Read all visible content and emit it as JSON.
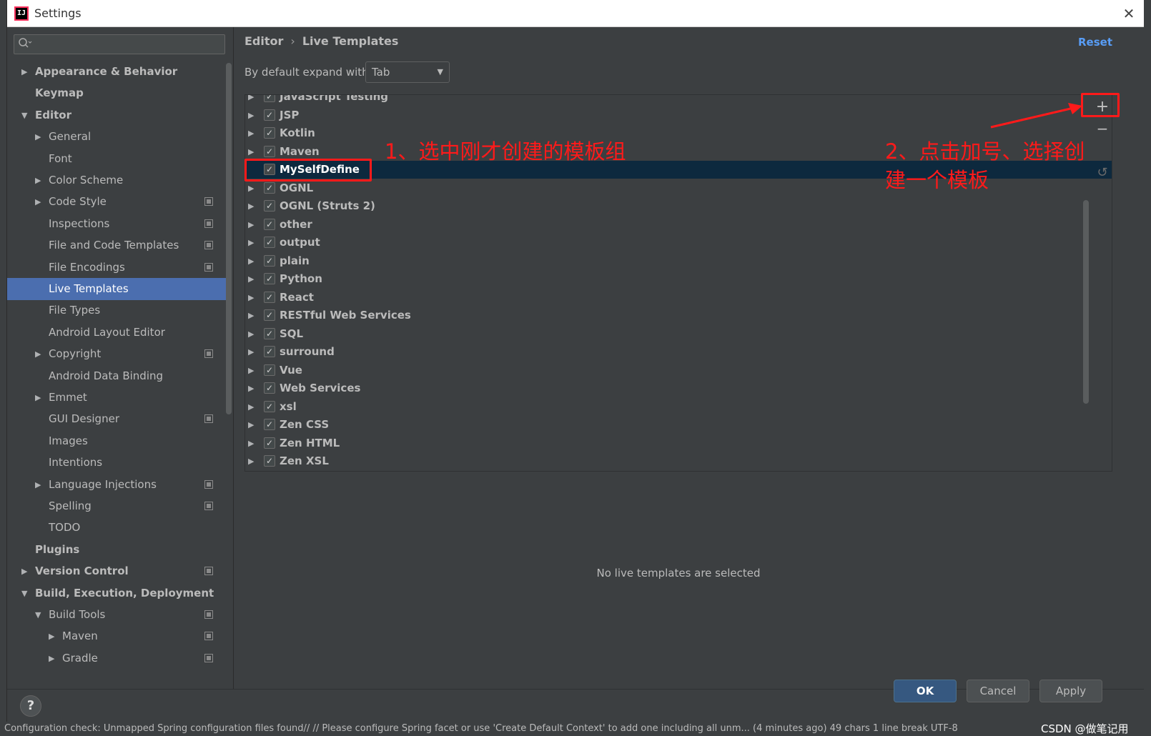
{
  "window": {
    "title": "Settings"
  },
  "search": {
    "placeholder": ""
  },
  "tree": [
    {
      "label": "Appearance & Behavior",
      "level": 0,
      "arrow": "right",
      "bold": true,
      "copy": false,
      "selected": false
    },
    {
      "label": "Keymap",
      "level": 0,
      "arrow": "none",
      "bold": true,
      "copy": false,
      "selected": false
    },
    {
      "label": "Editor",
      "level": 0,
      "arrow": "down",
      "bold": true,
      "copy": false,
      "selected": false
    },
    {
      "label": "General",
      "level": 1,
      "arrow": "right",
      "bold": false,
      "copy": false,
      "selected": false
    },
    {
      "label": "Font",
      "level": 1,
      "arrow": "none",
      "bold": false,
      "copy": false,
      "selected": false
    },
    {
      "label": "Color Scheme",
      "level": 1,
      "arrow": "right",
      "bold": false,
      "copy": false,
      "selected": false
    },
    {
      "label": "Code Style",
      "level": 1,
      "arrow": "right",
      "bold": false,
      "copy": true,
      "selected": false
    },
    {
      "label": "Inspections",
      "level": 1,
      "arrow": "none",
      "bold": false,
      "copy": true,
      "selected": false
    },
    {
      "label": "File and Code Templates",
      "level": 1,
      "arrow": "none",
      "bold": false,
      "copy": true,
      "selected": false
    },
    {
      "label": "File Encodings",
      "level": 1,
      "arrow": "none",
      "bold": false,
      "copy": true,
      "selected": false
    },
    {
      "label": "Live Templates",
      "level": 1,
      "arrow": "none",
      "bold": false,
      "copy": false,
      "selected": true
    },
    {
      "label": "File Types",
      "level": 1,
      "arrow": "none",
      "bold": false,
      "copy": false,
      "selected": false
    },
    {
      "label": "Android Layout Editor",
      "level": 1,
      "arrow": "none",
      "bold": false,
      "copy": false,
      "selected": false
    },
    {
      "label": "Copyright",
      "level": 1,
      "arrow": "right",
      "bold": false,
      "copy": true,
      "selected": false
    },
    {
      "label": "Android Data Binding",
      "level": 1,
      "arrow": "none",
      "bold": false,
      "copy": false,
      "selected": false
    },
    {
      "label": "Emmet",
      "level": 1,
      "arrow": "right",
      "bold": false,
      "copy": false,
      "selected": false
    },
    {
      "label": "GUI Designer",
      "level": 1,
      "arrow": "none",
      "bold": false,
      "copy": true,
      "selected": false
    },
    {
      "label": "Images",
      "level": 1,
      "arrow": "none",
      "bold": false,
      "copy": false,
      "selected": false
    },
    {
      "label": "Intentions",
      "level": 1,
      "arrow": "none",
      "bold": false,
      "copy": false,
      "selected": false
    },
    {
      "label": "Language Injections",
      "level": 1,
      "arrow": "right",
      "bold": false,
      "copy": true,
      "selected": false
    },
    {
      "label": "Spelling",
      "level": 1,
      "arrow": "none",
      "bold": false,
      "copy": true,
      "selected": false
    },
    {
      "label": "TODO",
      "level": 1,
      "arrow": "none",
      "bold": false,
      "copy": false,
      "selected": false
    },
    {
      "label": "Plugins",
      "level": 0,
      "arrow": "none",
      "bold": true,
      "copy": false,
      "selected": false
    },
    {
      "label": "Version Control",
      "level": 0,
      "arrow": "right",
      "bold": true,
      "copy": true,
      "selected": false
    },
    {
      "label": "Build, Execution, Deployment",
      "level": 0,
      "arrow": "down",
      "bold": true,
      "copy": false,
      "selected": false
    },
    {
      "label": "Build Tools",
      "level": 1,
      "arrow": "down",
      "bold": false,
      "copy": true,
      "selected": false
    },
    {
      "label": "Maven",
      "level": 2,
      "arrow": "right",
      "bold": false,
      "copy": true,
      "selected": false
    },
    {
      "label": "Gradle",
      "level": 2,
      "arrow": "right",
      "bold": false,
      "copy": true,
      "selected": false
    }
  ],
  "breadcrumb": {
    "parent": "Editor",
    "separator": "›",
    "current": "Live Templates"
  },
  "reset_label": "Reset",
  "expand": {
    "label": "By default expand with",
    "value": "Tab"
  },
  "groups": [
    {
      "label": "JavaScript Testing",
      "selected": false
    },
    {
      "label": "JSP",
      "selected": false
    },
    {
      "label": "Kotlin",
      "selected": false
    },
    {
      "label": "Maven",
      "selected": false
    },
    {
      "label": "MySelfDefine",
      "selected": true
    },
    {
      "label": "OGNL",
      "selected": false
    },
    {
      "label": "OGNL (Struts 2)",
      "selected": false
    },
    {
      "label": "other",
      "selected": false
    },
    {
      "label": "output",
      "selected": false
    },
    {
      "label": "plain",
      "selected": false
    },
    {
      "label": "Python",
      "selected": false
    },
    {
      "label": "React",
      "selected": false
    },
    {
      "label": "RESTful Web Services",
      "selected": false
    },
    {
      "label": "SQL",
      "selected": false
    },
    {
      "label": "surround",
      "selected": false
    },
    {
      "label": "Vue",
      "selected": false
    },
    {
      "label": "Web Services",
      "selected": false
    },
    {
      "label": "xsl",
      "selected": false
    },
    {
      "label": "Zen CSS",
      "selected": false
    },
    {
      "label": "Zen HTML",
      "selected": false
    },
    {
      "label": "Zen XSL",
      "selected": false
    }
  ],
  "toolbar": {
    "add": "+",
    "remove": "−",
    "restore": "↺"
  },
  "empty_message": "No live templates are selected",
  "buttons": {
    "ok": "OK",
    "cancel": "Cancel",
    "apply": "Apply",
    "help": "?"
  },
  "annotations": {
    "step1": "1、选中刚才创建的模板组",
    "step2_line1": "2、点击加号、选择创",
    "step2_line2": "建一个模板"
  },
  "background": {
    "status_text": "Configuration check: Unmapped Spring configuration files found// // Please configure Spring facet or use 'Create Default Context' to add one including all unm... (4 minutes ago)       49 chars   1 line break   UTF-8",
    "watermark": "CSDN @做笔记用"
  },
  "colors": {
    "accent": "#4b6eaf",
    "list_selection": "#0d293e",
    "link": "#589df6",
    "ok_button": "#365880",
    "annotation": "#ff1a1a"
  },
  "icons": {
    "app": "intellij-icon",
    "search": "search-icon",
    "close": "close-icon",
    "copy": "project-copy-icon",
    "expand": "chevron-right-icon",
    "collapse": "chevron-down-icon",
    "dropdown": "chevron-down-icon",
    "checkbox": "checkmark-icon",
    "help": "help-icon"
  }
}
